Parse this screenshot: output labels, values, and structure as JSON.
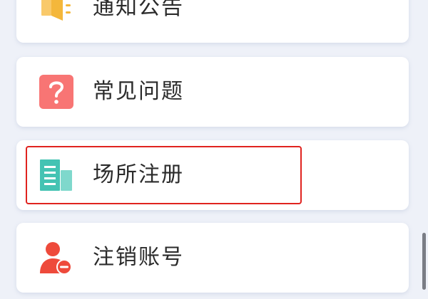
{
  "menu": {
    "items": [
      {
        "label": "通知公告",
        "icon": "announcement-icon",
        "color": "#f4b73b"
      },
      {
        "label": "常见问题",
        "icon": "question-icon",
        "color": "#f87574"
      },
      {
        "label": "场所注册",
        "icon": "building-icon",
        "color": "#44c3b3",
        "highlighted": true
      },
      {
        "label": "注销账号",
        "icon": "delete-account-icon",
        "color": "#ee4a3b"
      }
    ]
  },
  "colors": {
    "highlight": "#e0231f",
    "page_bg": "#eef1f8"
  }
}
